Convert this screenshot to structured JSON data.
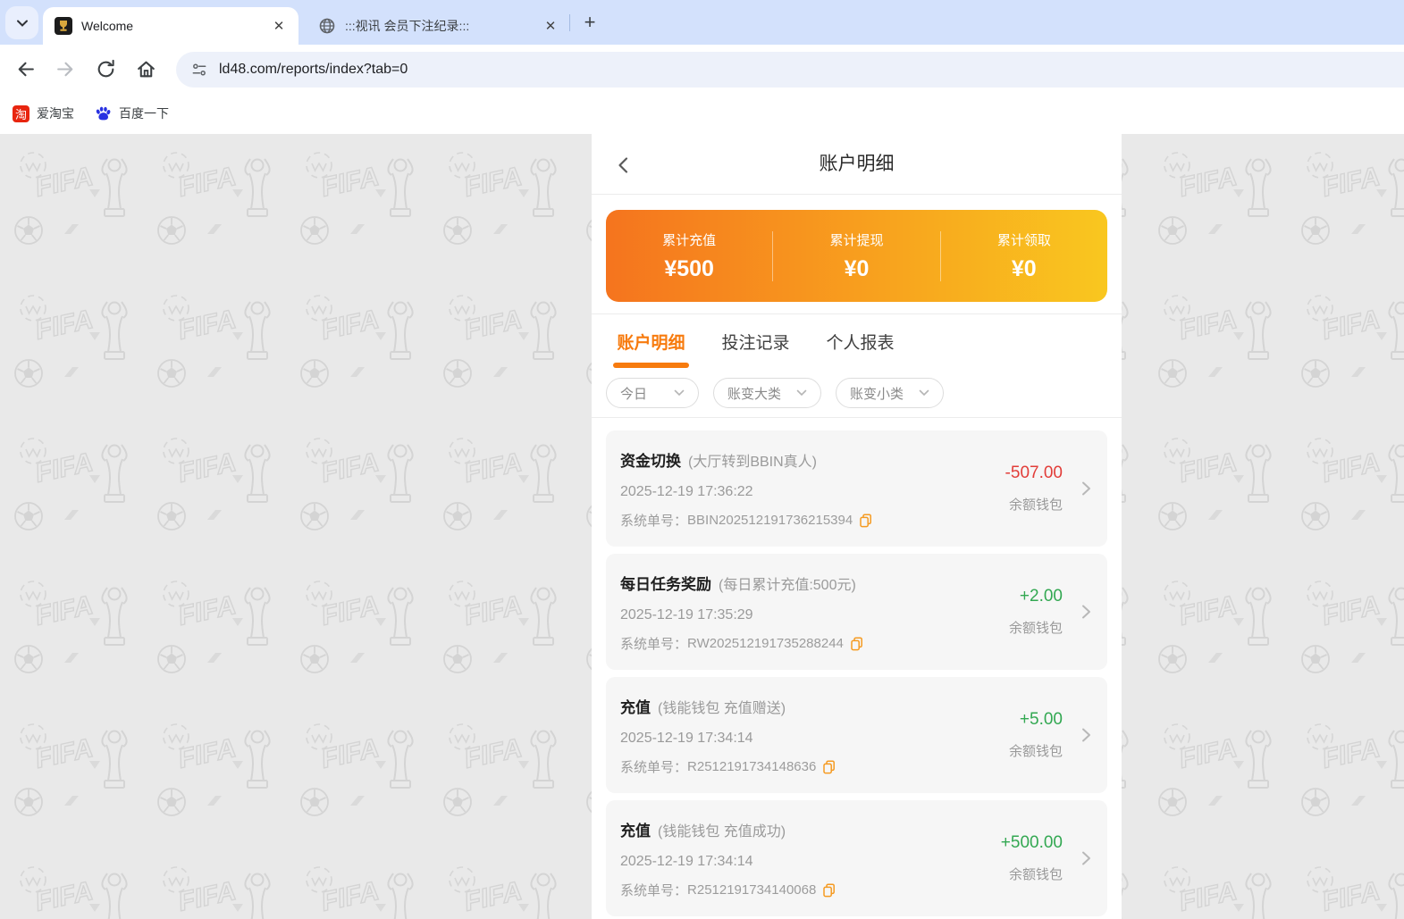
{
  "theme": {
    "accent": "#f77b0e",
    "tabstrip": "#d3e1fc",
    "neg": "#e23d39",
    "pos": "#33a852"
  },
  "browser": {
    "tabs": [
      {
        "title": "Welcome"
      },
      {
        "title": ":::视讯 会员下注纪录:::"
      }
    ],
    "close_glyph": "✕",
    "new_tab_glyph": "+",
    "url": "ld48.com/reports/index?tab=0",
    "bookmarks": [
      {
        "label": "爱淘宝",
        "badge": "淘"
      },
      {
        "label": "百度一下"
      }
    ]
  },
  "panel": {
    "title": "账户明细",
    "summary": [
      {
        "label": "累计充值",
        "value": "¥500"
      },
      {
        "label": "累计提现",
        "value": "¥0"
      },
      {
        "label": "累计领取",
        "value": "¥0"
      }
    ],
    "tabs": [
      {
        "label": "账户明细"
      },
      {
        "label": "投注记录"
      },
      {
        "label": "个人报表"
      }
    ],
    "filters": [
      {
        "label": "今日"
      },
      {
        "label": "账变大类"
      },
      {
        "label": "账变小类"
      }
    ],
    "order_label": "系统单号：",
    "transactions": [
      {
        "title": "资金切换",
        "note": "(大厅转到BBIN真人)",
        "datetime": "2025-12-19 17:36:22",
        "order_no": "BBIN202512191736215394",
        "amount": "-507.00",
        "wallet": "余额钱包"
      },
      {
        "title": "每日任务奖励",
        "note": "(每日累计充值:500元)",
        "datetime": "2025-12-19 17:35:29",
        "order_no": "RW202512191735288244",
        "amount": "+2.00",
        "wallet": "余额钱包"
      },
      {
        "title": "充值",
        "note": "(钱能钱包 充值赠送)",
        "datetime": "2025-12-19 17:34:14",
        "order_no": "R2512191734148636",
        "amount": "+5.00",
        "wallet": "余额钱包"
      },
      {
        "title": "充值",
        "note": "(钱能钱包 充值成功)",
        "datetime": "2025-12-19 17:34:14",
        "order_no": "R2512191734140068",
        "amount": "+500.00",
        "wallet": "余额钱包"
      }
    ]
  }
}
